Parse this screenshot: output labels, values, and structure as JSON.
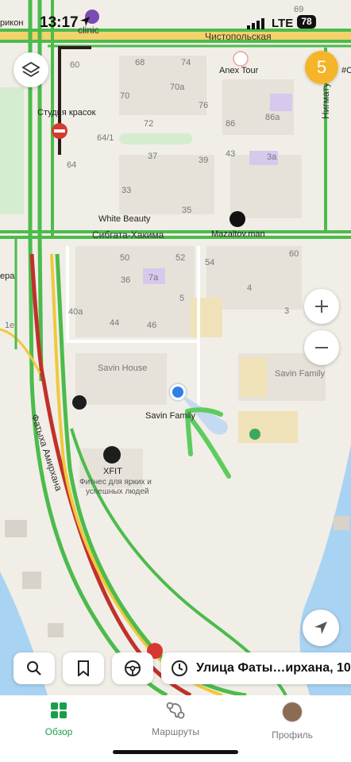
{
  "status_bar": {
    "time": "13:17",
    "network": "LTE",
    "battery": "78"
  },
  "map": {
    "streets": {
      "chistopolskaya": "Чистопольская",
      "sibgata": "Сибгата-Хакима",
      "nigmatullina": "Нигматуллина",
      "fatykh": "Фатыха Амирхана",
      "clinic_road": "clinic"
    },
    "pois": {
      "studio": "Студия красок",
      "anex": "Anex Tour",
      "white_beauty": "White Beauty",
      "mazaltov": "Mazaltov.man",
      "savin_house": "Savin House",
      "savin_family_east": "Savin Family",
      "savin_family_marker": "Savin Family",
      "xfit_name": "XFIT",
      "xfit_desc1": "Фитнес для ярких и",
      "xfit_desc2": "успешных людей",
      "left_edge1": "рикон",
      "left_edge2": "ера",
      "right_edge": "#C"
    },
    "houses": [
      "69",
      "60",
      "68",
      "74",
      "70",
      "70а",
      "76",
      "72",
      "86",
      "86а",
      "64/1",
      "37",
      "39",
      "43",
      "3а",
      "64",
      "33",
      "35",
      "50",
      "52",
      "54",
      "60",
      "36",
      "7а",
      "5",
      "4",
      "40а",
      "44",
      "46",
      "3",
      "1е"
    ],
    "traffic_level": "5"
  },
  "toolbar": {
    "address": "Улица Фаты…ирхана, 10"
  },
  "tabs": [
    {
      "label": "Обзор"
    },
    {
      "label": "Маршруты"
    },
    {
      "label": "Профиль"
    }
  ],
  "colors": {
    "accent": "#1a9e4a",
    "traffic_green": "#4cbb4c",
    "traffic_red": "#c0312b",
    "traffic_yellow": "#f0c83c",
    "water": "#a9d3f2",
    "park": "#d6ecd0",
    "badge": "#f5b52a"
  }
}
